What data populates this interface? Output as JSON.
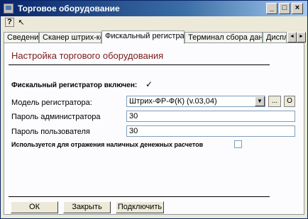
{
  "window": {
    "title": "Торговое оборудование",
    "controls": {
      "minimize": "_",
      "maximize": "□",
      "close": "×"
    }
  },
  "toolbar": {
    "help_icon": "?",
    "pointer_icon": "↖"
  },
  "tabs": [
    {
      "label": "Сведения"
    },
    {
      "label": "Сканер штрих-кода"
    },
    {
      "label": "Фискальный регистратор"
    },
    {
      "label": "Терминал сбора данных"
    },
    {
      "label": "Диспле"
    }
  ],
  "tab_scroll": {
    "left": "◄",
    "right": "►"
  },
  "form": {
    "heading": "Настройка торгового оборудования",
    "fiscal_enabled_label": "Фискальный регистратор включен:",
    "fiscal_enabled": true,
    "check_mark": "✓",
    "model_label": "Модель регистратора:",
    "model_value": "Штрих-ФР-Ф(К) (v.03,04)",
    "browse_button": "...",
    "clear_button": "О",
    "admin_password_label": "Пароль администратора",
    "admin_password_value": "30",
    "user_password_label": "Пароль пользователя",
    "user_password_value": "30",
    "cash_label": "Используется для отражения наличных денежных расчетов",
    "cash_checked": false
  },
  "buttons": {
    "ok": "ОК",
    "close": "Закрыть",
    "connect": "Подключить"
  },
  "colors": {
    "heading": "#7a1a1a",
    "titlebar": "#0a246a"
  }
}
